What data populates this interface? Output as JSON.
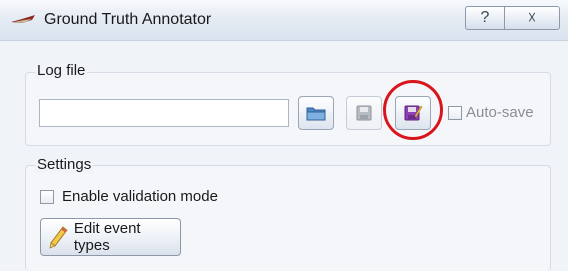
{
  "window": {
    "title": "Ground Truth Annotator",
    "help_glyph": "?",
    "close_glyph": "☓"
  },
  "log_group": {
    "label": "Log file",
    "path_value": "",
    "autosave_label": "Auto-save",
    "autosave_checked": false
  },
  "settings_group": {
    "label": "Settings",
    "validation_label": "Enable validation mode",
    "validation_checked": false,
    "edit_button_label": "Edit event types"
  },
  "icons": {
    "app": "app-icon",
    "open": "folder-icon",
    "save": "floppy-disk-icon",
    "save_as": "floppy-edit-icon",
    "edit": "pencil-icon"
  },
  "colors": {
    "highlight_ring": "#d9151c",
    "save_as_icon": "#8e3fb5"
  }
}
